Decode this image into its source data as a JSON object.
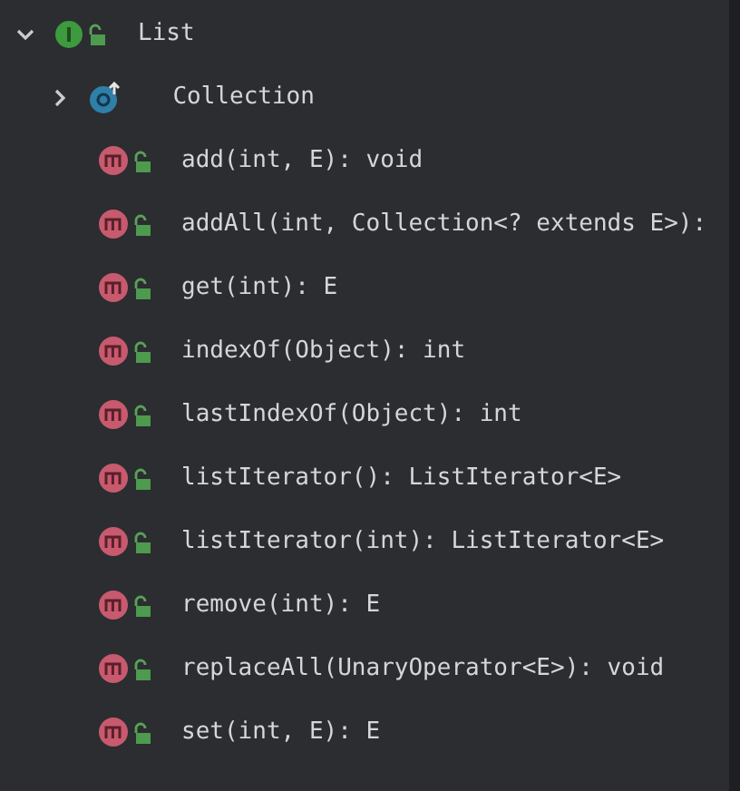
{
  "tree": [
    {
      "label": "List",
      "kind": "interface",
      "expanded": true,
      "children": [
        {
          "label": "Collection",
          "kind": "class",
          "expanded": false
        },
        {
          "label": "add(int, E): void",
          "kind": "method"
        },
        {
          "label": "addAll(int, Collection<? extends E>):",
          "kind": "method"
        },
        {
          "label": "get(int): E",
          "kind": "method"
        },
        {
          "label": "indexOf(Object): int",
          "kind": "method"
        },
        {
          "label": "lastIndexOf(Object): int",
          "kind": "method"
        },
        {
          "label": "listIterator(): ListIterator<E>",
          "kind": "method"
        },
        {
          "label": "listIterator(int): ListIterator<E>",
          "kind": "method"
        },
        {
          "label": "remove(int): E",
          "kind": "method"
        },
        {
          "label": "replaceAll(UnaryOperator<E>): void",
          "kind": "method"
        },
        {
          "label": "set(int, E): E",
          "kind": "method"
        }
      ]
    }
  ]
}
